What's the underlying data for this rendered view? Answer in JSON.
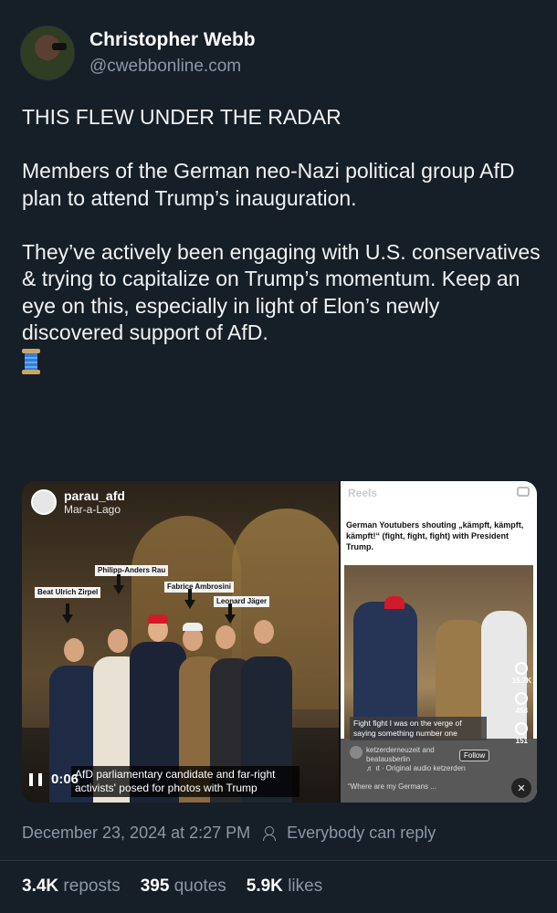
{
  "post": {
    "author": {
      "display_name": "Christopher Webb",
      "handle": "@cwebbonline.com"
    },
    "paragraphs": [
      "THIS FLEW UNDER THE RADAR",
      "Members of the German neo-Nazi political group AfD plan to attend Trump’s inauguration.",
      "They’ve actively been engaging with U.S. conservatives & trying to capitalize on Trump’s momentum. Keep an eye on this, especially in light of Elon’s newly discovered support of AfD."
    ],
    "emoji_icon": "thread-spool-icon",
    "timestamp": "December 23, 2024 at 2:27 PM",
    "reply_setting": "Everybody can reply",
    "stats": {
      "reposts_count": "3.4K",
      "reposts_label": "reposts",
      "quotes_count": "395",
      "quotes_label": "quotes",
      "likes_count": "5.9K",
      "likes_label": "likes"
    }
  },
  "media": {
    "left": {
      "username": "parau_afd",
      "location": "Mar-a-Lago",
      "tags": {
        "t1": "Philipp-Anders Rau",
        "t2": "Beat Ulrich Zirpel",
        "t3": "Fabrice Ambrosini",
        "t4": "Leonard Jäger"
      },
      "time": "0:06",
      "caption": "AfD parliamentary candidate and far-right activists' posed for photos with Trump"
    },
    "right": {
      "label": "Reels",
      "title": "German Youtubers shouting „kämpft, kämpft, kämpft!“ (fight, fight, fight) with President Trump.",
      "likes": "15.7K",
      "comments": "458",
      "shares": "151",
      "subtitle": "Fight fight I was on the verge of saying something number one",
      "user_line1": "ketzerderneuzeit and",
      "user_line2": "beatausberlin",
      "audio": "♬ ıt · Original audio   ketzerderı",
      "follow": "Follow",
      "comment": "“Where are my Germans ..."
    }
  }
}
